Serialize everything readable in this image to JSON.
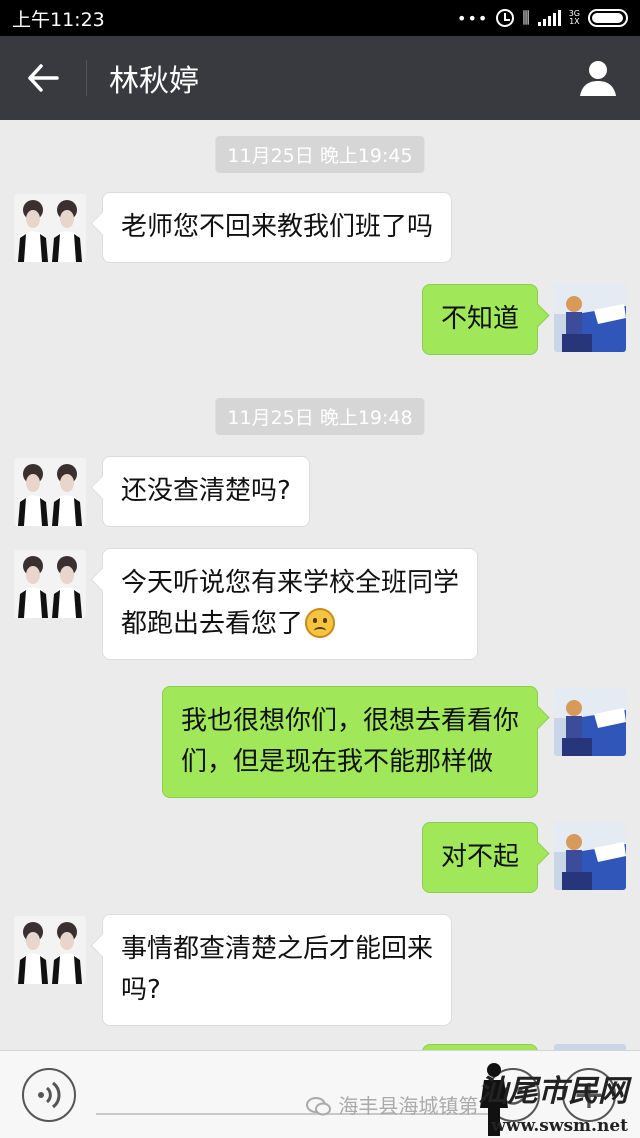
{
  "status_bar": {
    "time": "上午11:23",
    "dots": "•••",
    "network": "3G",
    "network_sub": "1X"
  },
  "header": {
    "back_icon": "arrow-left-icon",
    "title": "林秋婷",
    "profile_icon": "person-icon"
  },
  "messages": [
    {
      "type": "time",
      "text": "11月25日 晚上19:45"
    },
    {
      "type": "received",
      "text": "老师您不回来教我们班了吗"
    },
    {
      "type": "sent",
      "text": "不知道"
    },
    {
      "type": "time",
      "text": "11月25日 晚上19:48"
    },
    {
      "type": "received",
      "text": "还没查清楚吗?"
    },
    {
      "type": "received",
      "line1": "今天听说您有来学校全班同学",
      "line2": "都跑出去看您了",
      "emoji": "sad-face-icon"
    },
    {
      "type": "sent",
      "line1": "我也很想你们，很想去看看你",
      "line2": "们，但是现在我不能那样做"
    },
    {
      "type": "sent",
      "text": "对不起"
    },
    {
      "type": "received",
      "line1": "事情都查清楚之后才能回来",
      "line2": "吗?"
    }
  ],
  "input_bar": {
    "voice_icon": "voice-icon",
    "emoji_icon": "emoji-icon",
    "plus_icon": "plus-icon",
    "plus_label": "+"
  },
  "watermark": {
    "text": "海丰县海城镇第",
    "logo_text": "汕尾市民网",
    "url": "www.swsm.net"
  },
  "colors": {
    "navbar": "#393a3f",
    "chat_background": "#ebebeb",
    "sent_bubble": "#a0e75a",
    "received_bubble": "#ffffff"
  }
}
